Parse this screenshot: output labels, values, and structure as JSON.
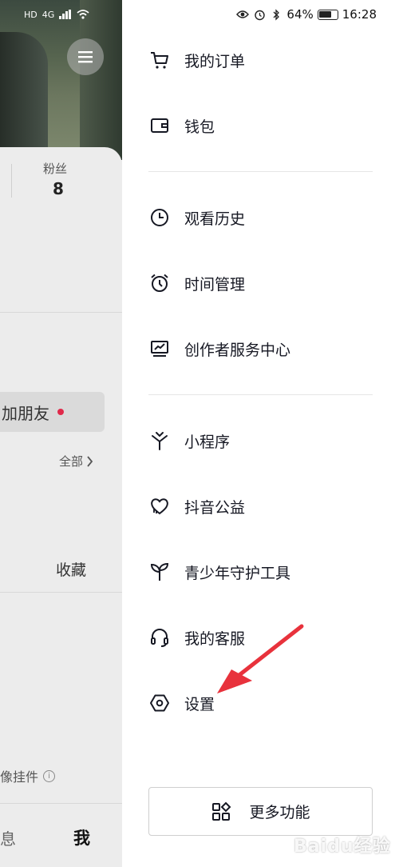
{
  "status_bar": {
    "battery": "64%",
    "time": "16:28",
    "left_indicators": [
      "HD",
      "4G"
    ]
  },
  "background": {
    "fans_label": "粉丝",
    "fans_count": "8",
    "add_friend": "加朋友",
    "all_label": "全部",
    "collect_tab": "收藏",
    "widget_label": "像挂件",
    "tab_messages": "息",
    "tab_me": "我"
  },
  "drawer": {
    "menu": [
      {
        "label": "我的订单",
        "icon": "cart-icon"
      },
      {
        "label": "钱包",
        "icon": "wallet-icon"
      },
      {
        "label": "观看历史",
        "icon": "clock-icon"
      },
      {
        "label": "时间管理",
        "icon": "alarm-clock-icon"
      },
      {
        "label": "创作者服务中心",
        "icon": "chart-monitor-icon"
      },
      {
        "label": "小程序",
        "icon": "mini-program-icon"
      },
      {
        "label": "抖音公益",
        "icon": "heart-charity-icon"
      },
      {
        "label": "青少年守护工具",
        "icon": "sprout-icon"
      },
      {
        "label": "我的客服",
        "icon": "headset-icon"
      },
      {
        "label": "设置",
        "icon": "settings-hexagon-icon"
      }
    ],
    "more_button": "更多功能"
  },
  "watermark": "Baidu经验",
  "colors": {
    "accent_red": "#e0294a",
    "annotation_arrow": "#e8323c",
    "text_primary": "#161823"
  }
}
